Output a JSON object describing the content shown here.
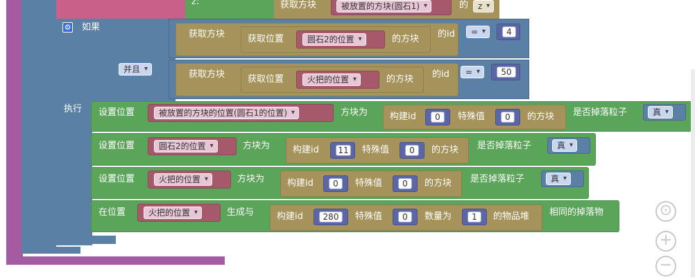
{
  "top": {
    "z_label": "z:",
    "get_block": "获取方块",
    "placed_block_dd": "被放置的方块(圆石1)",
    "of": "的",
    "z_dd": "z"
  },
  "if_block": {
    "if_label": "如果",
    "and_dd": "并且",
    "do_label": "执行",
    "cond1": {
      "get_block": "获取方块",
      "get_pos": "获取位置",
      "var": "圆石2的位置",
      "of_block": "的方块",
      "id": "的id",
      "op": "=",
      "value": "4"
    },
    "cond2": {
      "get_block": "获取方块",
      "get_pos": "获取位置",
      "var": "火把的位置",
      "of_block": "的方块",
      "id": "的id",
      "op": "=",
      "value": "50"
    }
  },
  "statements": [
    {
      "set_pos": "设置位置",
      "var": "被放置的方块的位置(圆石1的位置)",
      "block_is": "方块为",
      "build_id": "构建id",
      "id_value": "0",
      "special": "特殊值",
      "special_value": "0",
      "of_block": "的方块",
      "drop_particles": "是否掉落粒子",
      "bool": "真"
    },
    {
      "set_pos": "设置位置",
      "var": "圆石2的位置",
      "block_is": "方块为",
      "build_id": "构建id",
      "id_value": "11",
      "special": "特殊值",
      "special_value": "0",
      "of_block": "的方块",
      "drop_particles": "是否掉落粒子",
      "bool": "真"
    },
    {
      "set_pos": "设置位置",
      "var": "火把的位置",
      "block_is": "方块为",
      "build_id": "构建id",
      "id_value": "0",
      "special": "特殊值",
      "special_value": "0",
      "of_block": "的方块",
      "drop_particles": "是否掉落粒子",
      "bool": "真"
    }
  ],
  "spawn": {
    "at_pos": "在位置",
    "var": "火把的位置",
    "generate": "生成与",
    "build_id": "构建id",
    "id_value": "280",
    "special": "特殊值",
    "special_value": "0",
    "count": "数量为",
    "count_value": "1",
    "item_stack": "的物品堆",
    "same_drop": "相同的掉落物"
  },
  "controls": {
    "recenter": "⊙",
    "zoom_in": "+",
    "zoom_out": "−"
  },
  "colors": {
    "logic": "#5b80a5",
    "action": "#5ba55b",
    "world": "#a5935b",
    "variable": "#a5596a",
    "math": "#5b67a5",
    "procedure": "#a55b9f"
  }
}
